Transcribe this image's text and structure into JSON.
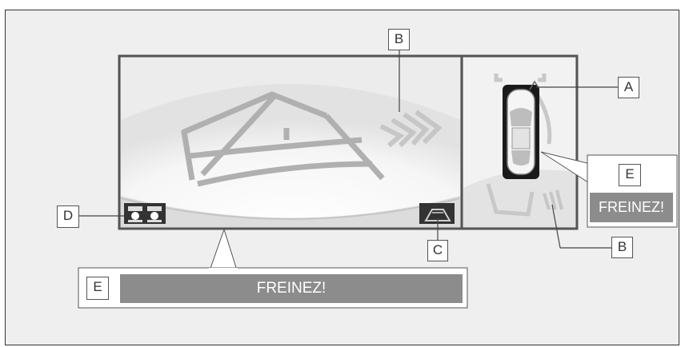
{
  "labels": {
    "A": "A",
    "B_top": "B",
    "B_bottom": "B",
    "C": "C",
    "D": "D",
    "E_small": "E",
    "E_large": "E"
  },
  "warnings": {
    "side_panel": "FREINEZ!",
    "bottom_banner": "FREINEZ!"
  },
  "colors": {
    "background": "#efefef",
    "screen_border": "#555555",
    "guide_lines": "#b0b0b0",
    "warning_bar": "#8c8c8c",
    "icon_box": "#333333",
    "vehicle_shadow": "#1a1a1a"
  }
}
